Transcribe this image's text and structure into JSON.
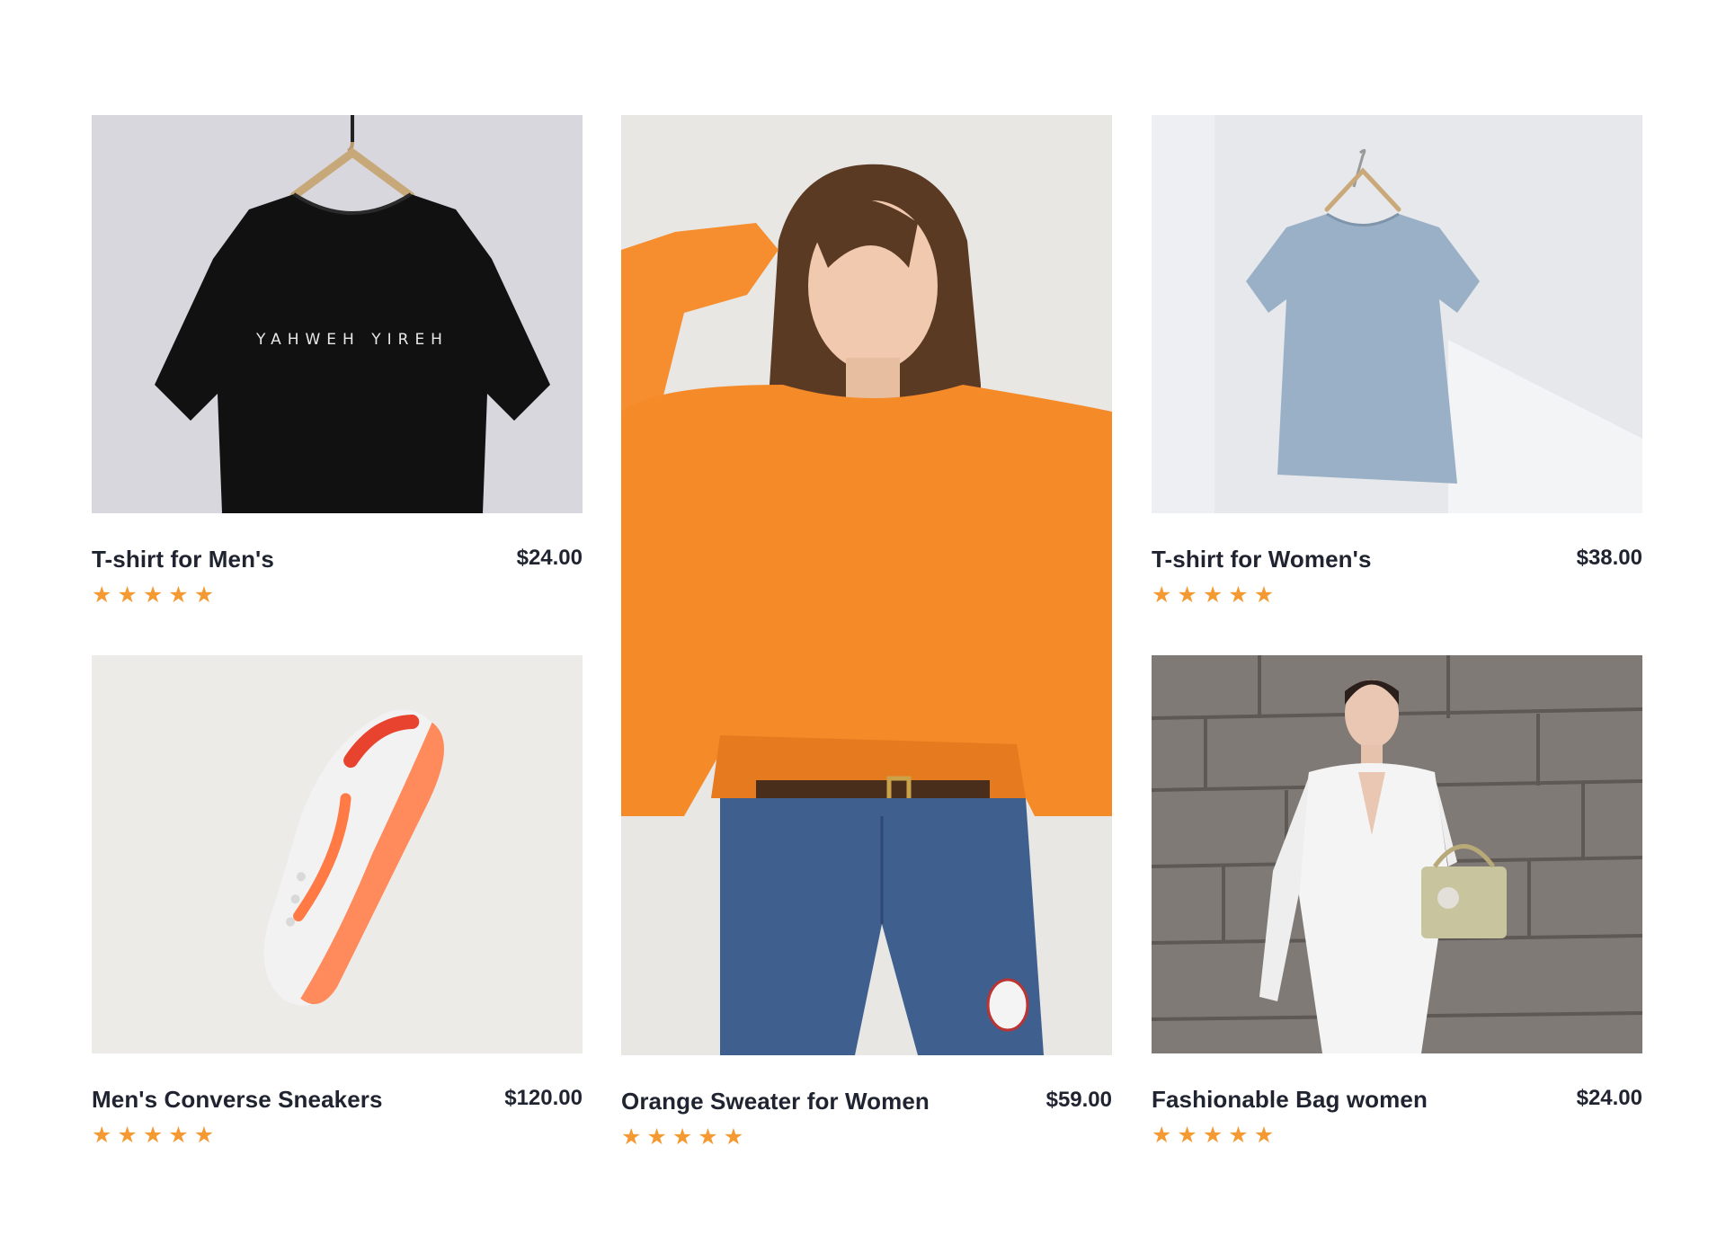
{
  "products": [
    {
      "name": "T-shirt for Men's",
      "price": "$24.00",
      "rating": 5,
      "image": "black-tshirt-on-hanger",
      "tshirt_print": "YAHWEH YIREH"
    },
    {
      "name": "Orange Sweater for Women",
      "price": "$59.00",
      "rating": 5,
      "image": "woman-in-orange-sweater"
    },
    {
      "name": "T-shirt for Women's",
      "price": "$38.00",
      "rating": 5,
      "image": "gray-tshirt-on-hanger"
    },
    {
      "name": "Men's Converse Sneakers",
      "price": "$120.00",
      "rating": 5,
      "image": "orange-white-sneaker"
    },
    {
      "name": "Fashionable Bag women",
      "price": "$24.00",
      "rating": 5,
      "image": "woman-holding-bag-stone-wall"
    }
  ],
  "star_glyph": "★",
  "colors": {
    "star": "#f59a32",
    "text": "#1f2430",
    "background": "#ffffff"
  }
}
